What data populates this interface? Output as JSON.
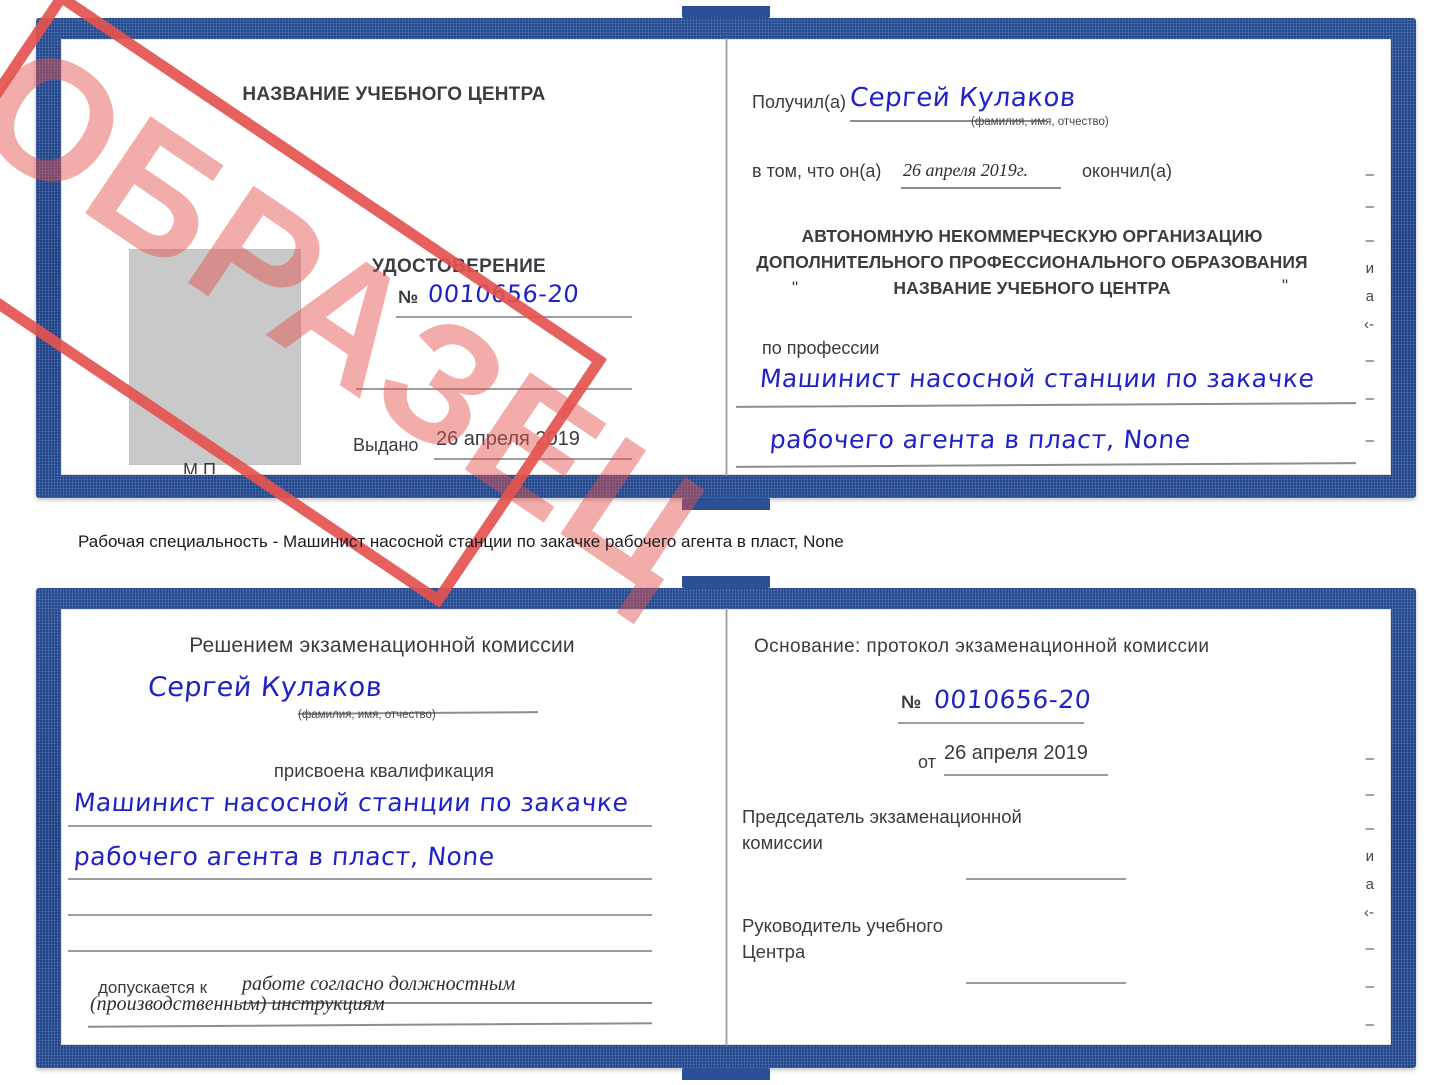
{
  "caption": {
    "text": "Рабочая специальность - Машинист насосной станции по закачке рабочего агента в пласт, None"
  },
  "stamp": {
    "label": "ОБРАЗЕЦ",
    "color": "#e4534f"
  },
  "colors": {
    "cover_blue": "#21478e",
    "handwriting_blue": "#1f22c8",
    "stamp_red": "#e4534f",
    "photo_gray": "#c9c9c9",
    "rule_gray": "#9b9ba2"
  },
  "certificate_top": {
    "left_page": {
      "center_name": "НАЗВАНИЕ УЧЕБНОГО ЦЕНТРА",
      "doc_type": "УДОСТОВЕРЕНИЕ",
      "number_symbol": "№",
      "number_value": "0010656-20",
      "issued_label": "Выдано",
      "issued_value": "26 апреля 2019",
      "seal_label": "М.П.",
      "photo_placeholder": ""
    },
    "right_page": {
      "received_label": "Получил(а)",
      "received_value": "Сергей Кулаков",
      "fio_hint": "(фамилия, имя, отчество)",
      "in_that_label": "в том, что он(а)",
      "in_that_date": "26 апреля 2019г.",
      "finished_label": "окончил(а)",
      "org_line_1": "АВТОНОМНУЮ НЕКОММЕРЧЕСКУЮ ОРГАНИЗАЦИЮ",
      "org_line_2": "ДОПОЛНИТЕЛЬНОГО ПРОФЕССИОНАЛЬНОГО ОБРАЗОВАНИЯ",
      "org_quote_open": "\"",
      "org_line_3": "НАЗВАНИЕ УЧЕБНОГО ЦЕНТРА",
      "org_quote_close": "\"",
      "profession_label": "по профессии",
      "profession_line_1": "Машинист насосной станции по закачке",
      "profession_line_2": "рабочего агента в пласт, None",
      "edge_fragments": [
        "–",
        "–",
        "–",
        "и",
        "а",
        "‹-",
        "–",
        "–",
        "–"
      ]
    }
  },
  "certificate_bottom": {
    "left_page": {
      "heading": "Решением экзаменационной комиссии",
      "name_value": "Сергей Кулаков",
      "fio_hint": "(фамилия, имя, отчество)",
      "qualification_label": "присвоена квалификация",
      "qualification_line_1": "Машинист насосной станции по закачке",
      "qualification_line_2": "рабочего агента в пласт, None",
      "admitted_label": "допускается к",
      "admitted_value_1": "работе согласно должностным",
      "admitted_value_2": "(производственным) инструкциям"
    },
    "right_page": {
      "basis_label": "Основание: протокол экзаменационной комиссии",
      "number_symbol": "№",
      "number_value": "0010656-20",
      "from_label": "от",
      "from_value": "26 апреля 2019",
      "chair_line_1": "Председатель экзаменационной",
      "chair_line_2": "комиссии",
      "head_line_1": "Руководитель учебного",
      "head_line_2": "Центра",
      "edge_fragments": [
        "–",
        "–",
        "–",
        "и",
        "а",
        "‹-",
        "–",
        "–",
        "–"
      ]
    }
  }
}
